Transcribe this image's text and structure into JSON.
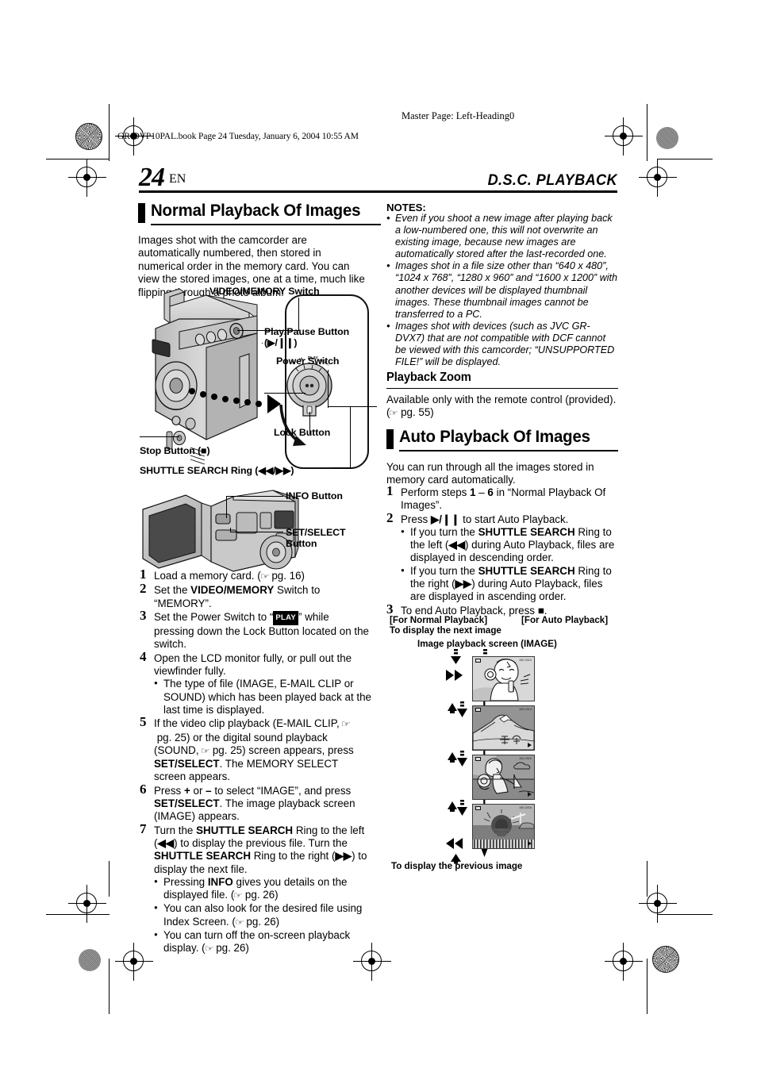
{
  "page": {
    "master_page": "Master Page: Left-Heading0",
    "book_line": "GR-DVP10PAL.book  Page 24  Tuesday, January 6, 2004  10:55 AM",
    "page_number": "24",
    "page_lang": "EN",
    "chapter_title": "D.S.C. PLAYBACK"
  },
  "left_column": {
    "section_title": "Normal Playback Of Images",
    "intro": "Images shot with the camcorder are automatically numbered, then stored in numerical order in the memory card. You can view the stored images, one at a time, much like flipping through a photo album.",
    "figure1": {
      "label_video_memory": "VIDEO/MEMORY Switch",
      "label_play_pause": "Play/Pause Button",
      "label_play_pause_sym": "(▶/❙❙)",
      "label_power_switch": "Power Switch",
      "label_lock_button": "Lock Button",
      "label_stop_button": "Stop Button (■)",
      "label_shuttle": "SHUTTLE SEARCH Ring (◀◀/▶▶)"
    },
    "figure2": {
      "label_info": "INFO Button",
      "label_set_select_l1": "SET/SELECT",
      "label_set_select_l2": "Button"
    },
    "steps": [
      {
        "n": "1",
        "text": "Load a memory card. (☞ pg. 16)"
      },
      {
        "n": "2",
        "text": "Set the VIDEO/MEMORY Switch to “MEMORY”."
      },
      {
        "n": "3",
        "text": "Set the Power Switch to “PLAY” while pressing down the Lock Button located on the switch."
      },
      {
        "n": "4",
        "text": "Open the LCD monitor fully, or pull out the viewfinder fully.",
        "bullets": [
          "The type of file (IMAGE, E-MAIL CLIP or SOUND) which has been played back at the last time is displayed."
        ]
      },
      {
        "n": "5",
        "text": "If the video clip playback (E-MAIL CLIP, ☞ pg. 25) or the digital sound playback (SOUND, ☞ pg. 25) screen appears, press SET/SELECT. The MEMORY SELECT screen appears."
      },
      {
        "n": "6",
        "text": "Press + or – to select “IMAGE”, and press SET/SELECT. The image playback screen (IMAGE) appears."
      },
      {
        "n": "7",
        "text": "Turn the SHUTTLE SEARCH Ring to the left (◀◀) to display the previous file. Turn the SHUTTLE SEARCH Ring to the right (▶▶) to display the next file.",
        "bullets": [
          "Pressing INFO gives you details on the displayed file. (☞ pg. 26)",
          "You can also look for the desired file using Index Screen. (☞ pg. 26)",
          "You can turn off the on-screen playback display. (☞ pg. 26)"
        ]
      }
    ]
  },
  "right_column": {
    "notes_heading": "NOTES:",
    "notes": [
      "Even if you shoot a new image after playing back a low-numbered one, this will not overwrite an existing image, because new images are automatically stored after the last-recorded one.",
      "Images shot in a file size other than “640 x 480”, “1024 x 768”, “1280 x 960” and “1600 x 1200” with another devices will be displayed thumbnail images. These thumbnail images cannot be transferred to a PC.",
      "Images shot with devices (such as JVC GR-DVX7) that are not compatible with DCF cannot be viewed with this camcorder; “UNSUPPORTED FILE!” will be displayed."
    ],
    "playback_zoom_heading": "Playback Zoom",
    "playback_zoom_text": "Available only with the remote control (provided). (☞ pg. 55)",
    "auto_section_title": "Auto Playback Of Images",
    "auto_intro": "You can run through all the images stored in memory card automatically.",
    "auto_steps": [
      {
        "n": "1",
        "text": "Perform steps 1 – 6 in “Normal Playback Of Images”."
      },
      {
        "n": "2",
        "text": "Press ▶/❙❙ to start Auto Playback.",
        "bullets": [
          "If you turn the SHUTTLE SEARCH Ring to the left (◀◀) during Auto Playback, files are displayed in descending order.",
          "If you turn the SHUTTLE SEARCH Ring to the right (▶▶) during Auto Playback, files are displayed in ascending order."
        ]
      },
      {
        "n": "3",
        "text": "To end Auto Playback, press ■."
      }
    ],
    "diagram": {
      "label_for_normal": "[For Normal Playback]",
      "label_for_auto": "[For Auto Playback]",
      "label_next_image": "To display the next image",
      "label_screen": "Image playback screen (IMAGE)",
      "label_prev_image": "To display the previous image",
      "sym_forward": "▶▶",
      "sym_rewind": "◀◀",
      "sym_play_pause": "▶/❙❙",
      "thumbnails": [
        {
          "file_no": "100-0013",
          "caption": "girl-portrait"
        },
        {
          "file_no": "100-0014",
          "caption": "mountain-landscape"
        },
        {
          "file_no": "100-0015",
          "caption": "woman-at-beach"
        },
        {
          "file_no": "100-0016",
          "caption": "sunset-over-water"
        }
      ]
    }
  },
  "colors": {
    "ink": "#000000",
    "grey_mid": "#9a9a9a",
    "grey_light": "#cfcfcf",
    "grey_dark": "#6e6e6e"
  }
}
